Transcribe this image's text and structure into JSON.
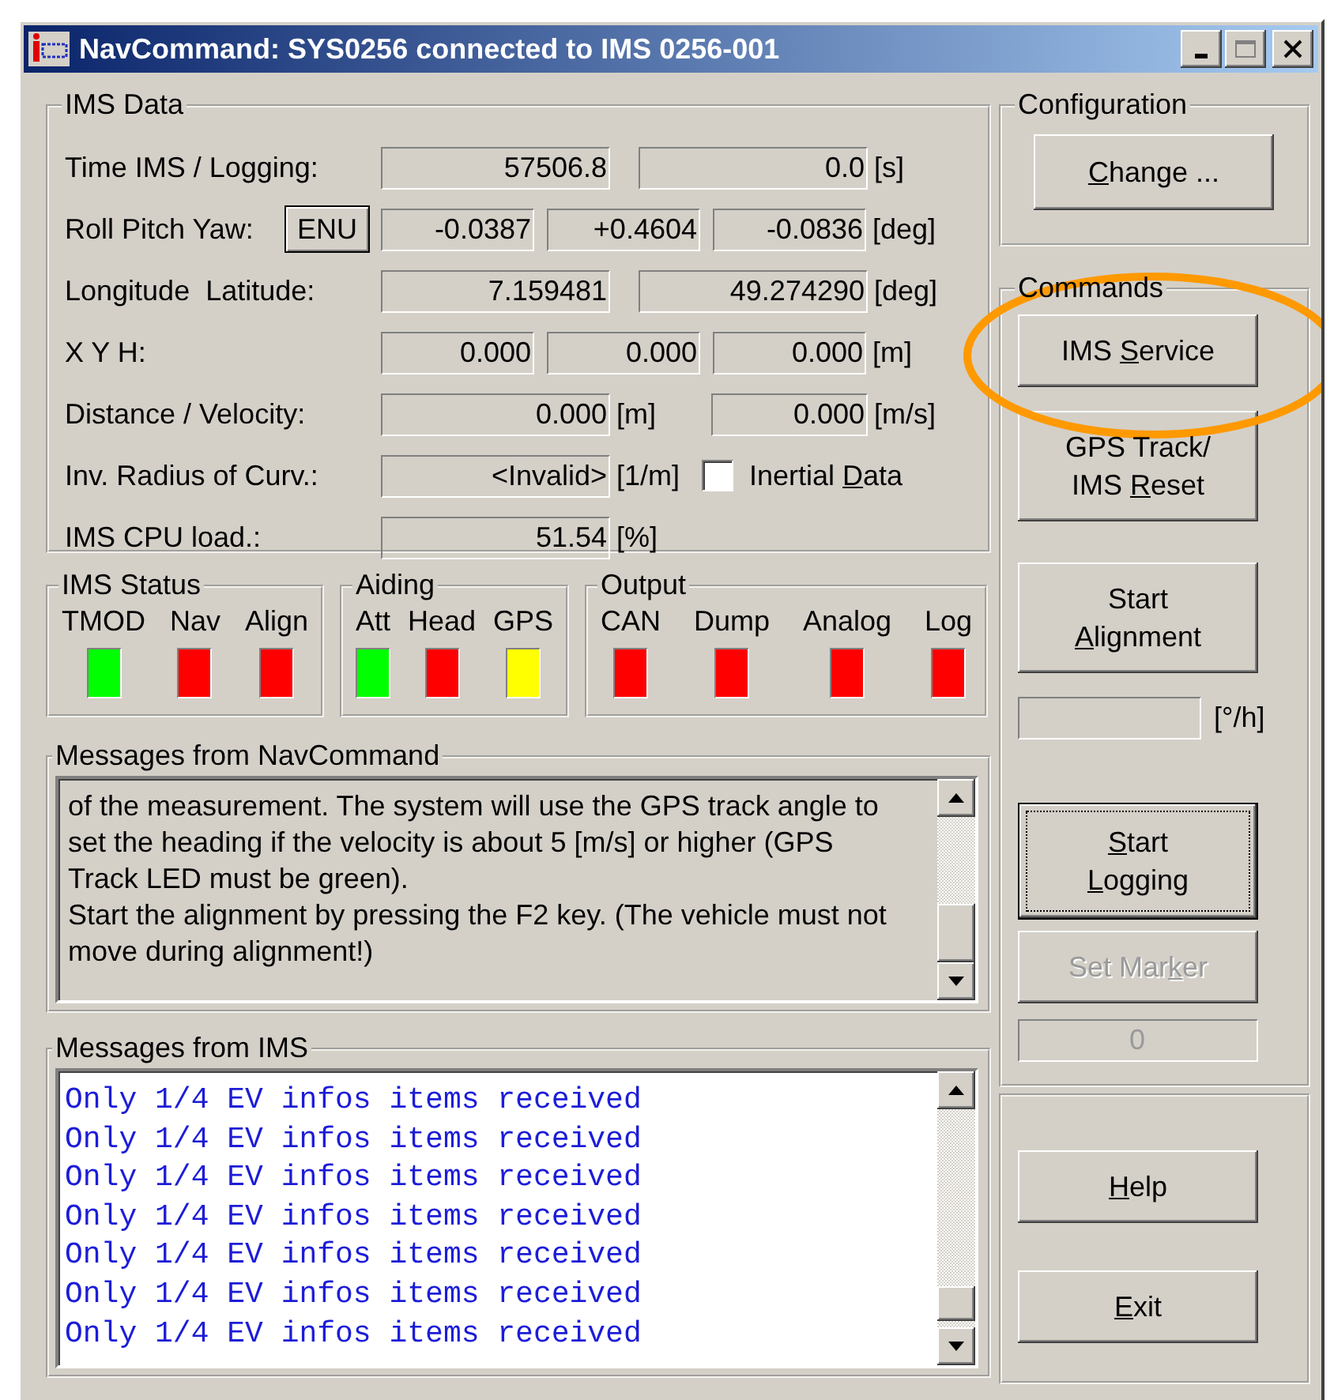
{
  "window": {
    "title": "NavCommand: SYS0256 connected to IMS 0256-001"
  },
  "ims_data": {
    "title": "IMS Data",
    "rows": [
      {
        "kind": "pair",
        "label": "Time IMS / Logging:",
        "fields": [
          "57506.8",
          "0.0"
        ],
        "unit": "[s]"
      },
      {
        "kind": "triple",
        "label": "Roll Pitch Yaw:",
        "button": "ENU",
        "fields": [
          "-0.0387",
          "+0.4604",
          "-0.0836"
        ],
        "unit": "[deg]"
      },
      {
        "kind": "pair",
        "label": "Longitude  Latitude:",
        "fields": [
          "7.159481",
          "49.274290"
        ],
        "unit": "[deg]"
      },
      {
        "kind": "triple",
        "label": "X Y H:",
        "fields": [
          "0.000",
          "0.000",
          "0.000"
        ],
        "unit": "[m]"
      },
      {
        "kind": "split",
        "label": "Distance / Velocity:",
        "fields": [
          "0.000",
          "0.000"
        ],
        "units": [
          "[m]",
          "[m/s]"
        ]
      },
      {
        "kind": "check",
        "label": "Inv. Radius of Curv.:",
        "fields": [
          "<Invalid>"
        ],
        "unit": "[1/m]",
        "checkbox": {
          "checked": false,
          "label": {
            "pre": "Inertial ",
            "key": "D",
            "post": "ata"
          }
        }
      },
      {
        "kind": "single",
        "label": "IMS CPU load.:",
        "fields": [
          "51.54"
        ],
        "unit": "[%]"
      }
    ]
  },
  "status_groups": [
    {
      "title": "IMS Status",
      "leds": [
        {
          "label": "TMOD",
          "color": "#00ff00"
        },
        {
          "label": "Nav",
          "color": "#ff0000"
        },
        {
          "label": "Align",
          "color": "#ff0000"
        }
      ]
    },
    {
      "title": "Aiding",
      "leds": [
        {
          "label": "Att",
          "color": "#00ff00"
        },
        {
          "label": "Head",
          "color": "#ff0000"
        },
        {
          "label": "GPS",
          "color": "#ffff00"
        }
      ]
    },
    {
      "title": "Output",
      "leds": [
        {
          "label": "CAN",
          "color": "#ff0000"
        },
        {
          "label": "Dump",
          "color": "#ff0000"
        },
        {
          "label": "Analog",
          "color": "#ff0000"
        },
        {
          "label": "Log",
          "color": "#ff0000"
        }
      ]
    }
  ],
  "navcommand_messages": {
    "title": "Messages from NavCommand",
    "paragraphs": [
      "of the measurement. The system will use the GPS track angle to set the heading if the velocity is about 5 [m/s] or higher (GPS Track LED must be green).",
      "Start the alignment by pressing the F2 key. (The vehicle must not move during alignment!)"
    ]
  },
  "ims_messages": {
    "title": "Messages from IMS",
    "lines": [
      "Only 1/4 EV infos items received",
      "Only 1/4 EV infos items received",
      "Only 1/4 EV infos items received",
      "Only 1/4 EV infos items received",
      "Only 1/4 EV infos items received",
      "Only 1/4 EV infos items received",
      "Only 1/4 EV infos items received"
    ]
  },
  "configuration": {
    "title": "Configuration",
    "button": [
      {
        "key": "C",
        "post": "hange ..."
      }
    ]
  },
  "commands": {
    "title": "Commands",
    "items": [
      {
        "kind": "button",
        "lines": [
          {
            "pre": "IMS ",
            "key": "S",
            "post": "ervice"
          }
        ],
        "default": false,
        "disabled": false
      },
      {
        "kind": "button",
        "lines": [
          {
            "pre": "GPS Track/"
          },
          {
            "pre": "IMS ",
            "key": "R",
            "post": "eset"
          }
        ],
        "default": false,
        "disabled": false
      },
      {
        "kind": "button",
        "lines": [
          {
            "pre": "Start"
          },
          {
            "key": "A",
            "post": "lignment"
          }
        ],
        "default": false,
        "disabled": false
      },
      {
        "kind": "field",
        "unit": "[°/h]"
      },
      {
        "kind": "button",
        "lines": [
          {
            "key": "S",
            "post": "tart"
          },
          {
            "key": "L",
            "post": "ogging"
          }
        ],
        "default": true,
        "disabled": false
      },
      {
        "kind": "button",
        "lines": [
          {
            "pre": "Set Mar",
            "key": "k",
            "post": "er"
          }
        ],
        "default": false,
        "disabled": true
      },
      {
        "kind": "field",
        "value": "0",
        "disabled": true
      }
    ]
  },
  "footer_buttons": [
    [
      {
        "key": "H",
        "post": "elp"
      }
    ],
    [
      {
        "key": "E",
        "post": "xit"
      }
    ]
  ]
}
